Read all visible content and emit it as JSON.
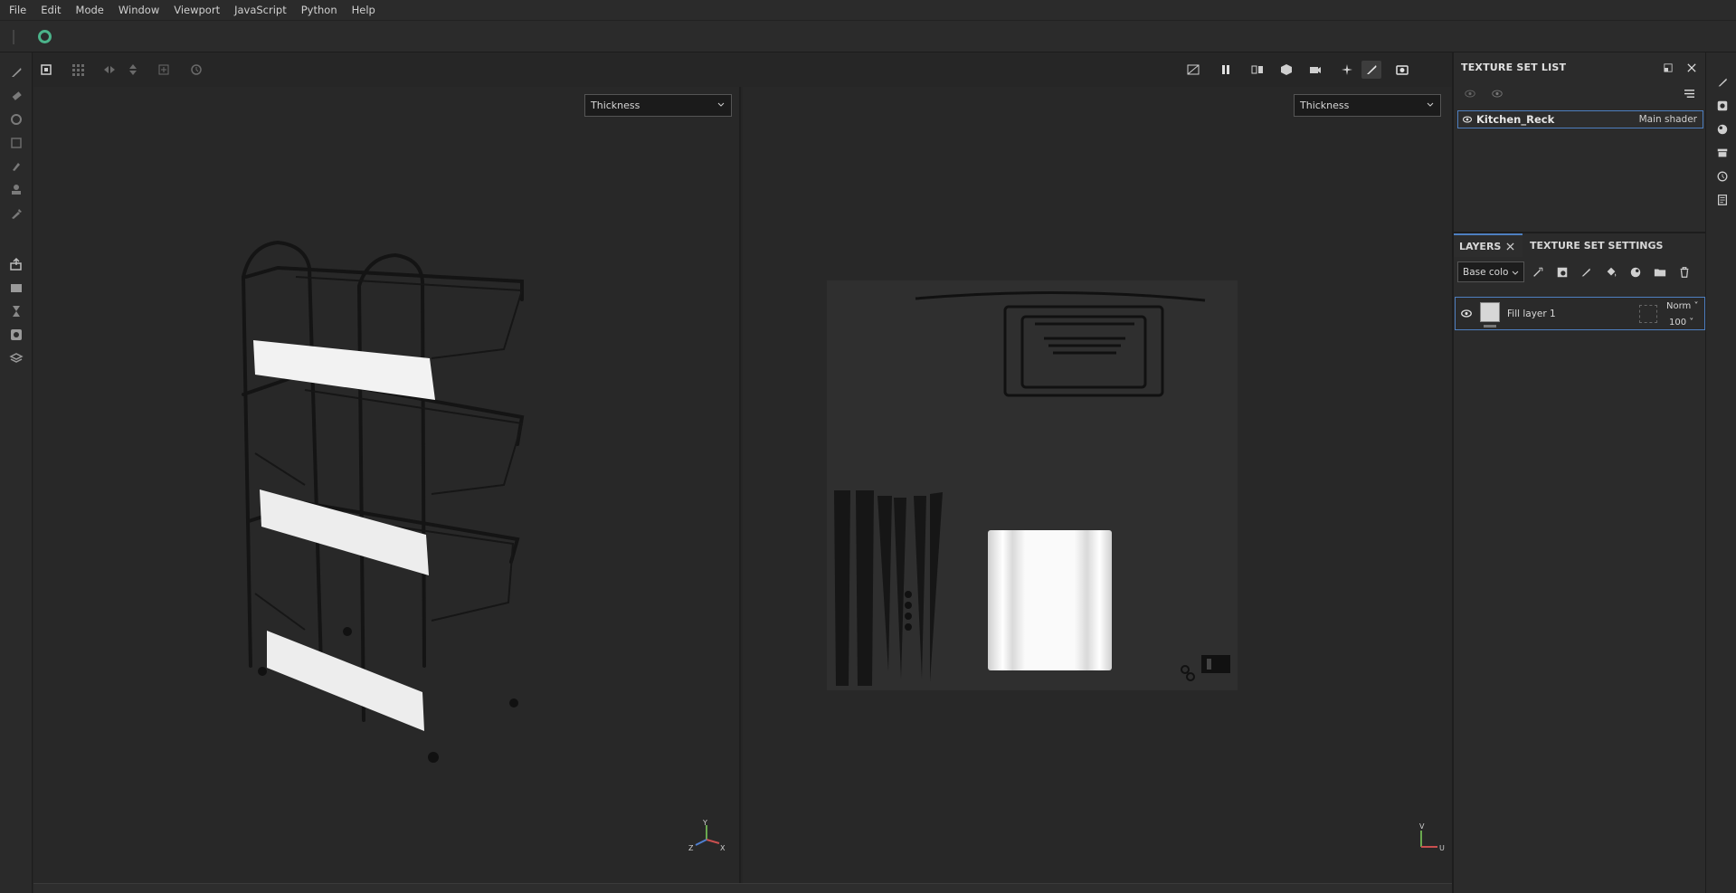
{
  "menu": [
    "File",
    "Edit",
    "Mode",
    "Window",
    "Viewport",
    "JavaScript",
    "Python",
    "Help"
  ],
  "viewport_left": {
    "channel": "Thickness"
  },
  "viewport_right": {
    "channel": "Thickness"
  },
  "texture_set_list": {
    "title": "TEXTURE SET LIST",
    "item_name": "Kitchen_Reck",
    "item_shader": "Main shader"
  },
  "layers_panel": {
    "tab_layers": "LAYERS",
    "tab_settings": "TEXTURE SET SETTINGS",
    "channel_select": "Base colo",
    "layer_name": "Fill layer 1",
    "blend_mode": "Norm",
    "opacity": "100"
  },
  "axis": {
    "y": "Y",
    "x": "X",
    "z": "Z",
    "u": "U",
    "v": "V"
  },
  "colors": {
    "accent": "#4e7fc0",
    "logo": "#4bb38a",
    "background": "#282828"
  }
}
